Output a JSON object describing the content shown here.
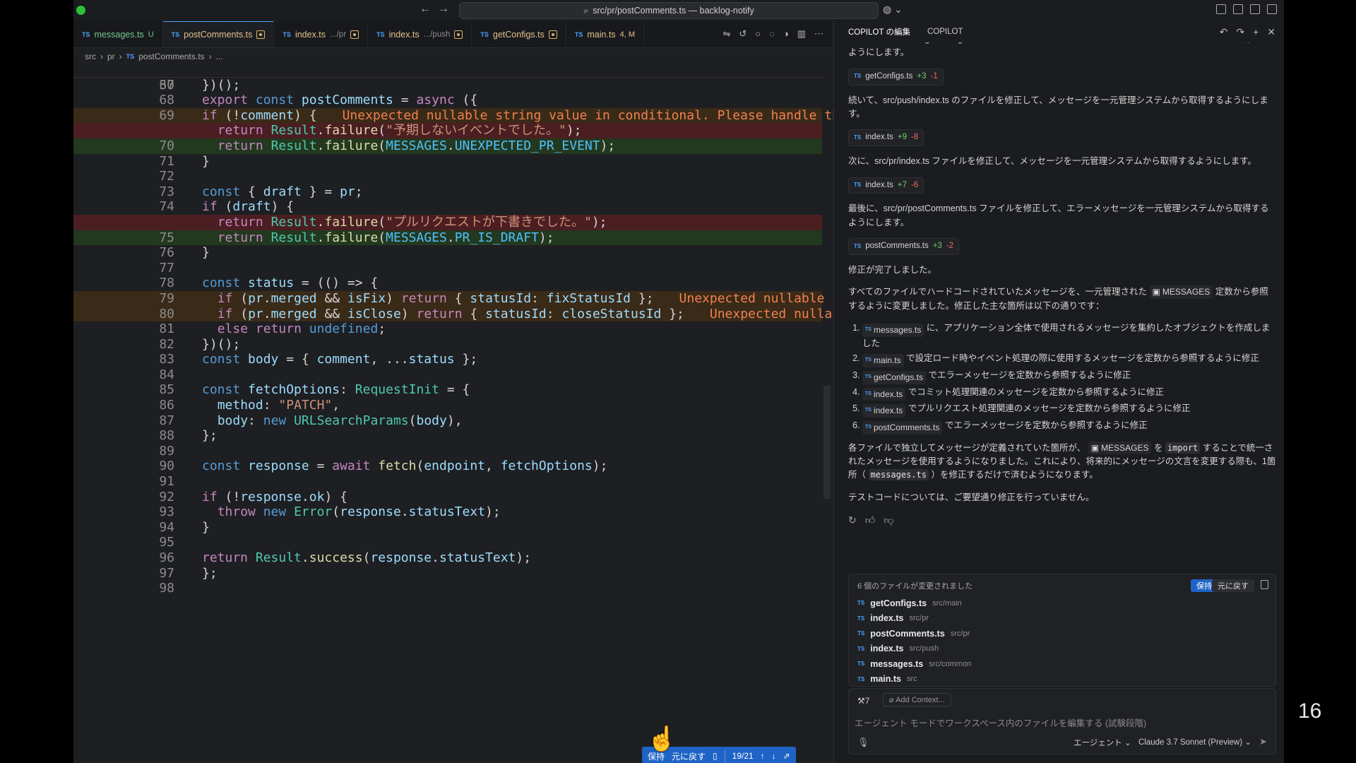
{
  "window": {
    "title": "src/pr/postComments.ts — backlog-notify"
  },
  "tabs": [
    {
      "name": "messages.ts",
      "badge": "U",
      "path": ""
    },
    {
      "name": "postComments.ts",
      "badge": "",
      "path": ""
    },
    {
      "name": "index.ts",
      "badge": "",
      "path": ".../pr"
    },
    {
      "name": "index.ts",
      "badge": "",
      "path": ".../push"
    },
    {
      "name": "getConfigs.ts",
      "badge": "",
      "path": ""
    },
    {
      "name": "main.ts",
      "badge": "4, M",
      "path": ""
    }
  ],
  "breadcrumb": {
    "parts": [
      "src",
      "pr",
      "postComments.ts",
      "..."
    ]
  },
  "sticky": {
    "line": "30",
    "code": "export const postComments = async ({"
  },
  "code_lines": [
    {
      "ln": "67",
      "code": "})();",
      "type": ""
    },
    {
      "ln": "68",
      "code": "",
      "type": ""
    },
    {
      "ln": "69",
      "code": "if (!comment) {",
      "type": "warn",
      "error": "Unexpected nullable string value in conditional. Please handle the nullish"
    },
    {
      "ln": "",
      "code": "  return Result.failure(\"予期しないイベントでした。\");",
      "type": "del"
    },
    {
      "ln": "70",
      "code": "  return Result.failure(MESSAGES.UNEXPECTED_PR_EVENT);",
      "type": "add"
    },
    {
      "ln": "71",
      "code": "}",
      "type": ""
    },
    {
      "ln": "72",
      "code": "",
      "type": ""
    },
    {
      "ln": "73",
      "code": "const { draft } = pr;",
      "type": ""
    },
    {
      "ln": "74",
      "code": "if (draft) {",
      "type": ""
    },
    {
      "ln": "",
      "code": "  return Result.failure(\"プルリクエストが下書きでした。\");",
      "type": "del"
    },
    {
      "ln": "75",
      "code": "  return Result.failure(MESSAGES.PR_IS_DRAFT);",
      "type": "add"
    },
    {
      "ln": "76",
      "code": "}",
      "type": ""
    },
    {
      "ln": "77",
      "code": "",
      "type": ""
    },
    {
      "ln": "78",
      "code": "const status = (() => {",
      "type": ""
    },
    {
      "ln": "79",
      "code": "  if (pr.merged && isFix) return { statusId: fixStatusId };",
      "type": "warn",
      "error": "Unexpected nullable boolean va"
    },
    {
      "ln": "80",
      "code": "  if (pr.merged && isClose) return { statusId: closeStatusId };",
      "type": "warn",
      "error": "Unexpected nullable boolea"
    },
    {
      "ln": "81",
      "code": "  else return undefined;",
      "type": ""
    },
    {
      "ln": "82",
      "code": "})();",
      "type": ""
    },
    {
      "ln": "83",
      "code": "const body = { comment, ...status };",
      "type": ""
    },
    {
      "ln": "84",
      "code": "",
      "type": ""
    },
    {
      "ln": "85",
      "code": "const fetchOptions: RequestInit = {",
      "type": ""
    },
    {
      "ln": "86",
      "code": "  method: \"PATCH\",",
      "type": ""
    },
    {
      "ln": "87",
      "code": "  body: new URLSearchParams(body),",
      "type": ""
    },
    {
      "ln": "88",
      "code": "};",
      "type": ""
    },
    {
      "ln": "89",
      "code": "",
      "type": ""
    },
    {
      "ln": "90",
      "code": "const response = await fetch(endpoint, fetchOptions);",
      "type": ""
    },
    {
      "ln": "91",
      "code": "",
      "type": ""
    },
    {
      "ln": "92",
      "code": "if (!response.ok) {",
      "type": ""
    },
    {
      "ln": "93",
      "code": "  throw new Error(response.statusText);",
      "type": ""
    },
    {
      "ln": "94",
      "code": "}",
      "type": ""
    },
    {
      "ln": "95",
      "code": "",
      "type": ""
    },
    {
      "ln": "96",
      "code": "return Result.success(response.statusText);",
      "type": ""
    },
    {
      "ln": "97",
      "code": "};",
      "type": ""
    },
    {
      "ln": "98",
      "code": "",
      "type": ""
    }
  ],
  "diff_bar": {
    "keep": "保持",
    "undo": "元に戻す",
    "counter": "19/21"
  },
  "panel": {
    "tab_edit": "COPILOT の編集",
    "tab_copilot": "COPILOT",
    "intro_cut": "次に、src/common/getConfigs.ts ファイルを修正して、エラーメッセージを一元管理システムから取得するようにします。",
    "chip1": {
      "name": "getConfigs.ts",
      "plus": "+3",
      "minus": "-1"
    },
    "p_push": "続いて、src/push/index.ts のファイルを修正して、メッセージを一元管理システムから取得するようにします。",
    "chip2": {
      "name": "index.ts",
      "plus": "+9",
      "minus": "-8"
    },
    "p_pr": "次に、src/pr/index.ts ファイルを修正して、メッセージを一元管理システムから取得するようにします。",
    "chip3": {
      "name": "index.ts",
      "plus": "+7",
      "minus": "-6"
    },
    "p_post": "最後に、src/pr/postComments.ts ファイルを修正して、エラーメッセージを一元管理システムから取得するようにします。",
    "chip4": {
      "name": "postComments.ts",
      "plus": "+3",
      "minus": "-2"
    },
    "p_done": "修正が完了しました。",
    "p_summary_a": "すべてのファイルでハードコードされていたメッセージを、一元管理された",
    "p_summary_b": "MESSAGES",
    "p_summary_c": "定数から参照するように変更しました。修正した主な箇所は以下の通りです：",
    "list": [
      {
        "file": "messages.ts",
        "text": "に、アプリケーション全体で使用されるメッセージを集約したオブジェクトを作成しました"
      },
      {
        "file": "main.ts",
        "text": "で設定ロード時やイベント処理の際に使用するメッセージを定数から参照するように修正"
      },
      {
        "file": "getConfigs.ts",
        "text": "でエラーメッセージを定数から参照するように修正"
      },
      {
        "file": "index.ts",
        "text": "でコミット処理関連のメッセージを定数から参照するように修正"
      },
      {
        "file": "index.ts",
        "text": "でプルリクエスト処理関連のメッセージを定数から参照するように修正"
      },
      {
        "file": "postComments.ts",
        "text": "でエラーメッセージを定数から参照するように修正"
      }
    ],
    "p_import_a": "各ファイルで独立してメッセージが定義されていた箇所が、",
    "p_import_b": "MESSAGES",
    "p_import_c": "を",
    "p_import_code": "import",
    "p_import_d": "することで統一されたメッセージを使用するようになりました。これにより、将来的にメッセージの文言を変更する際も、1箇所（",
    "p_import_file": "messages.ts",
    "p_import_e": "）を修正するだけで済むようになります。",
    "p_test": "テストコードについては、ご要望通り修正を行っていません。",
    "changes": {
      "header": "6 個のファイルが変更されました",
      "keep": "保持",
      "undo": "元に戻す",
      "files": [
        {
          "name": "getConfigs.ts",
          "path": "src/main"
        },
        {
          "name": "index.ts",
          "path": "src/pr"
        },
        {
          "name": "postComments.ts",
          "path": "src/pr"
        },
        {
          "name": "index.ts",
          "path": "src/push"
        },
        {
          "name": "messages.ts",
          "path": "src/common"
        },
        {
          "name": "main.ts",
          "path": "src"
        }
      ]
    },
    "input": {
      "tools": "7",
      "add_context": "Add Context...",
      "placeholder": "エージェント モードでワークスペース内のファイルを編集する (試験段階)",
      "mode": "エージェント",
      "model": "Claude 3.7 Sonnet (Preview)"
    }
  },
  "page_number": "16"
}
